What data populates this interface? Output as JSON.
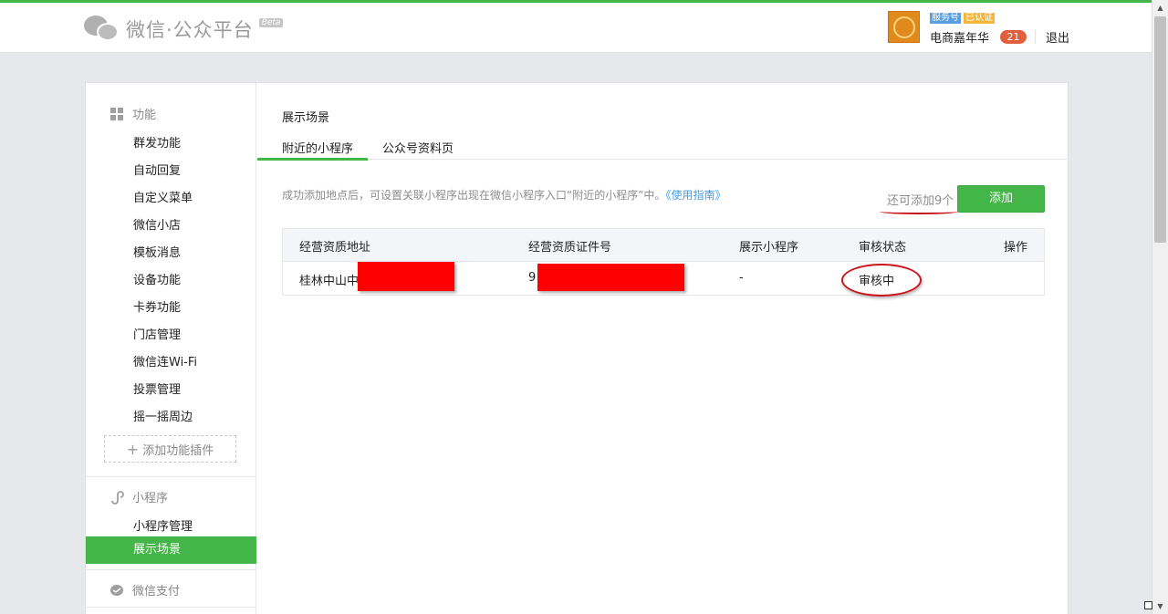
{
  "header": {
    "logo_text": "微信·公众平台",
    "logo_beta": "Beta",
    "account_badge_type": "服务号",
    "account_badge_verified": "已认证",
    "account_name": "电商嘉年华",
    "message_count": "21",
    "logout_label": "退出"
  },
  "sidebar": {
    "features_title": "功能",
    "features_items": [
      "群发功能",
      "自动回复",
      "自定义菜单",
      "微信小店",
      "模板消息",
      "设备功能",
      "卡券功能",
      "门店管理",
      "微信连Wi-Fi",
      "投票管理",
      "摇一摇周边"
    ],
    "add_plugin_label": "添加功能插件",
    "miniprogram_title": "小程序",
    "miniprogram_items": [
      "小程序管理",
      "展示场景"
    ],
    "pay_title": "微信支付"
  },
  "content": {
    "page_title": "展示场景",
    "tabs": [
      "附近的小程序",
      "公众号资料页"
    ],
    "hint_text": "成功添加地点后，可设置关联小程序出现在微信小程序入口“附近的小程序”中。",
    "hint_link": "《使用指南》",
    "remaining_text": "还可添加9个",
    "add_button_label": "添加",
    "table": {
      "headers": [
        "经营资质地址",
        "经营资质证件号",
        "展示小程序",
        "审核状态",
        "操作"
      ],
      "rows": [
        {
          "address": "桂林中山中",
          "license_no": "9",
          "miniprogram": "-",
          "status": "审核中",
          "action": ""
        }
      ]
    }
  },
  "colors": {
    "brand_green": "#44b549",
    "link_blue": "#459ae9",
    "annotation_red": "#c9141c",
    "redaction_red": "#ff0000"
  }
}
